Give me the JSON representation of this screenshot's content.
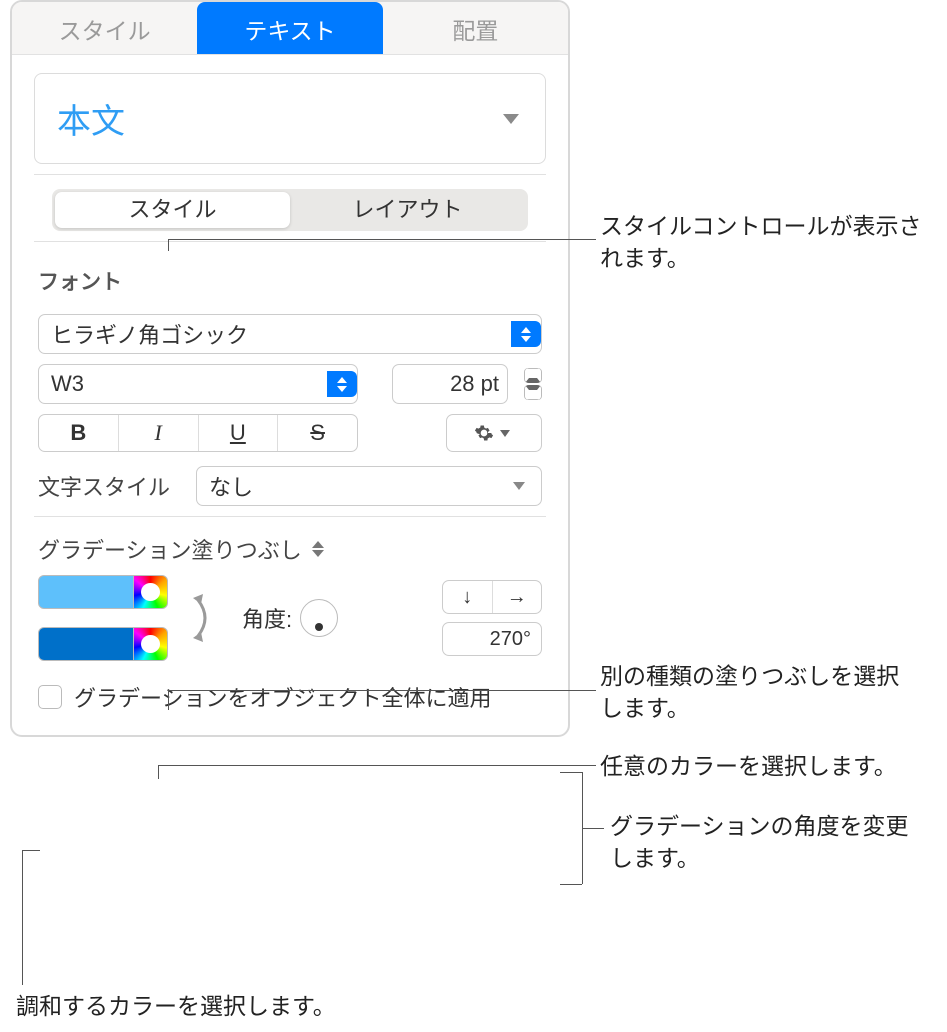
{
  "tabs": {
    "style": "スタイル",
    "text": "テキスト",
    "arrange": "配置"
  },
  "paragraph_style": "本文",
  "sub_tabs": {
    "style": "スタイル",
    "layout": "レイアウト"
  },
  "font": {
    "header": "フォント",
    "family": "ヒラギノ角ゴシック",
    "weight": "W3",
    "size": "28 pt",
    "char_style_label": "文字スタイル",
    "char_style_value": "なし"
  },
  "style_buttons": {
    "bold": "B",
    "italic": "I",
    "underline": "U",
    "strike": "S"
  },
  "gradient": {
    "label": "グラデーション塗りつぶし",
    "angle_label": "角度:",
    "angle_value": "270°",
    "color1": "#5ec0fb",
    "color2": "#0070c9",
    "apply_all": "グラデーションをオブジェクト全体に適用"
  },
  "callouts": {
    "c1": "スタイルコントロールが表示されます。",
    "c2": "別の種類の塗りつぶしを選択します。",
    "c3": "任意のカラーを選択します。",
    "c4": "グラデーションの角度を変更します。",
    "c5": "調和するカラーを選択します。"
  }
}
